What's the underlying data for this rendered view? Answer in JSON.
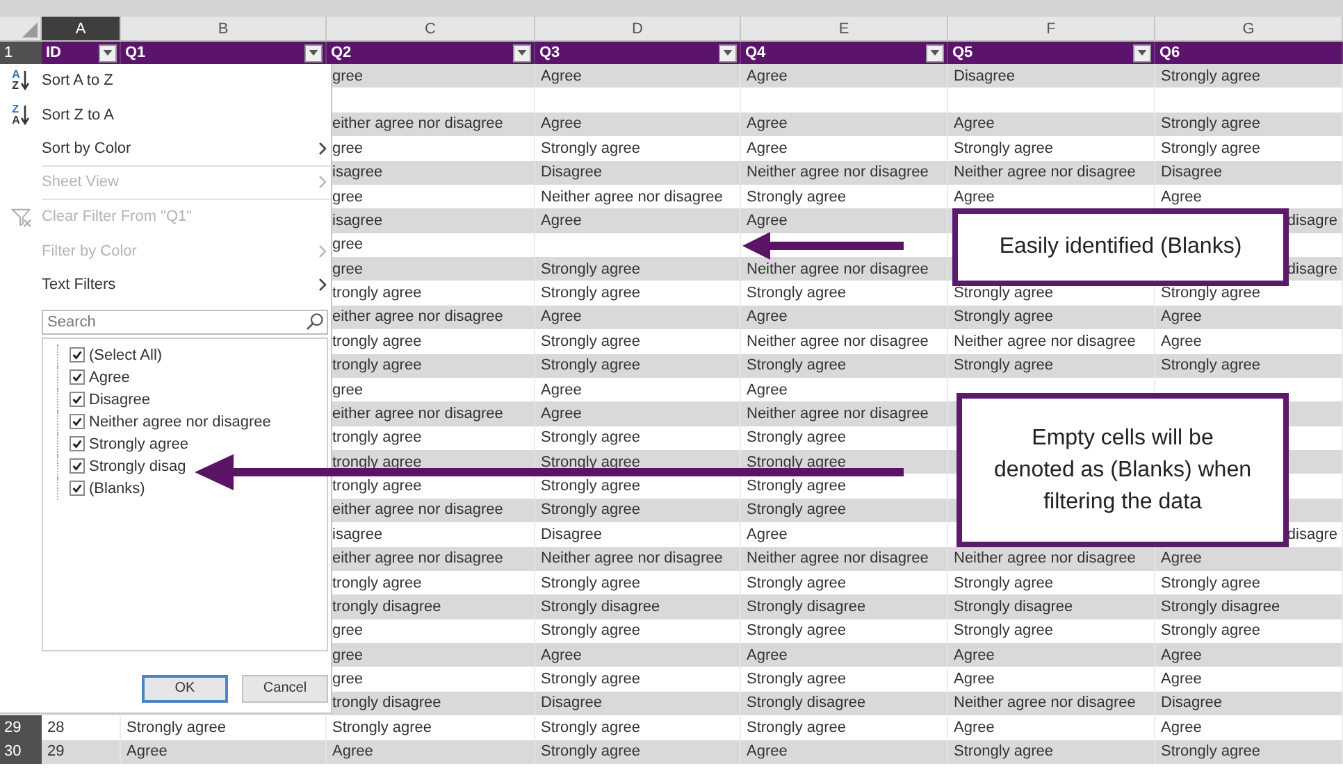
{
  "sheet": {
    "column_letters": [
      {
        "label": "A",
        "selected": true
      },
      {
        "label": "B",
        "selected": false
      },
      {
        "label": "C",
        "selected": false
      },
      {
        "label": "D",
        "selected": false
      },
      {
        "label": "E",
        "selected": false
      },
      {
        "label": "F",
        "selected": false
      },
      {
        "label": "G",
        "selected": false
      }
    ],
    "header_row": {
      "number": "1",
      "cells": [
        {
          "label": "ID",
          "filter": true
        },
        {
          "label": "Q1",
          "filter": true
        },
        {
          "label": "Q2",
          "filter": true
        },
        {
          "label": "Q3",
          "filter": true
        },
        {
          "label": "Q4",
          "filter": true
        },
        {
          "label": "Q5",
          "filter": true
        },
        {
          "label": "Q6",
          "filter": false
        }
      ]
    },
    "rows": [
      {
        "cells": [
          null,
          null,
          "gree",
          "Agree",
          "Agree",
          "Disagree",
          "Strongly agree"
        ]
      },
      {
        "cells": [
          null,
          null,
          null,
          null,
          null,
          null,
          null
        ]
      },
      {
        "cells": [
          null,
          null,
          "either agree nor disagree",
          "Agree",
          "Agree",
          "Agree",
          "Strongly agree"
        ]
      },
      {
        "cells": [
          null,
          null,
          "gree",
          "Strongly agree",
          "Agree",
          "Strongly agree",
          "Strongly agree"
        ]
      },
      {
        "cells": [
          null,
          null,
          "isagree",
          "Disagree",
          "Neither agree nor disagree",
          "Neither agree nor disagree",
          "Disagree"
        ]
      },
      {
        "cells": [
          null,
          null,
          "gree",
          "Neither agree nor disagree",
          "Strongly agree",
          "Agree",
          "Agree"
        ]
      },
      {
        "cells": [
          null,
          null,
          "isagree",
          "Agree",
          "Agree",
          null,
          {
            "text": "disagre",
            "clipped": true
          }
        ]
      },
      {
        "cells": [
          null,
          null,
          "gree",
          null,
          null,
          null,
          null
        ]
      },
      {
        "cells": [
          null,
          null,
          "gree",
          "Strongly agree",
          "Neither agree nor disagree",
          null,
          {
            "text": "disagre",
            "clipped": true
          }
        ]
      },
      {
        "cells": [
          null,
          null,
          "trongly agree",
          "Strongly agree",
          "Strongly agree",
          "Strongly agree",
          "Strongly agree"
        ]
      },
      {
        "cells": [
          null,
          null,
          "either agree nor disagree",
          "Agree",
          "Agree",
          "Strongly agree",
          "Agree"
        ]
      },
      {
        "cells": [
          null,
          null,
          "trongly agree",
          "Strongly agree",
          "Neither agree nor disagree",
          "Neither agree nor disagree",
          "Agree"
        ]
      },
      {
        "cells": [
          null,
          null,
          "trongly agree",
          "Strongly agree",
          "Strongly agree",
          "Strongly agree",
          "Strongly agree"
        ]
      },
      {
        "cells": [
          null,
          null,
          "gree",
          "Agree",
          "Agree",
          null,
          null
        ]
      },
      {
        "cells": [
          null,
          null,
          "either agree nor disagree",
          "Agree",
          "Neither agree nor disagree",
          null,
          null
        ]
      },
      {
        "cells": [
          null,
          null,
          "trongly agree",
          "Strongly agree",
          "Strongly agree",
          null,
          null
        ]
      },
      {
        "cells": [
          null,
          null,
          "trongly agree",
          "Strongly agree",
          "Strongly agree",
          null,
          null
        ]
      },
      {
        "cells": [
          null,
          null,
          "trongly agree",
          "Strongly agree",
          "Strongly agree",
          null,
          null
        ]
      },
      {
        "cells": [
          null,
          null,
          "either agree nor disagree",
          "Strongly agree",
          "Strongly agree",
          null,
          null
        ]
      },
      {
        "cells": [
          null,
          null,
          "isagree",
          "Disagree",
          "Agree",
          null,
          {
            "text": "disagre",
            "clipped": true
          }
        ]
      },
      {
        "cells": [
          null,
          null,
          "either agree nor disagree",
          "Neither agree nor disagree",
          "Neither agree nor disagree",
          "Neither agree nor disagree",
          "Agree"
        ]
      },
      {
        "cells": [
          null,
          null,
          "trongly agree",
          "Strongly agree",
          "Strongly agree",
          "Strongly agree",
          "Strongly agree"
        ]
      },
      {
        "cells": [
          null,
          null,
          "trongly disagree",
          "Strongly disagree",
          "Strongly disagree",
          "Strongly disagree",
          "Strongly disagree"
        ]
      },
      {
        "cells": [
          null,
          null,
          "gree",
          "Strongly agree",
          "Strongly agree",
          "Strongly agree",
          "Strongly agree"
        ]
      },
      {
        "cells": [
          null,
          null,
          "gree",
          "Agree",
          "Agree",
          "Agree",
          "Agree"
        ]
      },
      {
        "cells": [
          null,
          null,
          "gree",
          "Strongly agree",
          "Strongly agree",
          "Agree",
          "Agree"
        ]
      },
      {
        "cells": [
          null,
          null,
          "trongly disagree",
          "Disagree",
          "Strongly disagree",
          "Neither agree nor disagree",
          "Disagree"
        ]
      },
      {
        "number": "29",
        "cells": [
          "28",
          "Strongly agree",
          "Strongly agree",
          "Strongly agree",
          "Strongly agree",
          "Agree",
          "Agree"
        ]
      },
      {
        "number": "30",
        "cells": [
          "29",
          "Agree",
          "Agree",
          "Strongly agree",
          "Agree",
          "Strongly agree",
          "Strongly agree"
        ]
      }
    ]
  },
  "filter_menu": {
    "items": [
      {
        "kind": "sort",
        "icon_letters": [
          "A",
          "Z"
        ],
        "label": "Sort A to Z",
        "disabled": false,
        "submenu": false,
        "divider_after": false
      },
      {
        "kind": "sort",
        "icon_letters": [
          "Z",
          "A"
        ],
        "label": "Sort Z to A",
        "disabled": false,
        "submenu": false,
        "divider_after": false
      },
      {
        "kind": "plain",
        "label": "Sort by Color",
        "disabled": false,
        "submenu": true,
        "divider_after": true
      },
      {
        "kind": "plain",
        "label": "Sheet View",
        "disabled": true,
        "submenu": true,
        "divider_after": true
      },
      {
        "kind": "clear",
        "label": "Clear Filter From \"Q1\"",
        "disabled": true,
        "submenu": false,
        "divider_after": false
      },
      {
        "kind": "plain",
        "label": "Filter by Color",
        "disabled": true,
        "submenu": true,
        "divider_after": false
      },
      {
        "kind": "plain",
        "label": "Text Filters",
        "disabled": false,
        "submenu": true,
        "divider_after": false
      }
    ],
    "search": {
      "placeholder": "Search"
    },
    "values": [
      {
        "label": "(Select All)",
        "checked": true
      },
      {
        "label": "Agree",
        "checked": true
      },
      {
        "label": "Disagree",
        "checked": true
      },
      {
        "label": "Neither agree nor disagree",
        "checked": true
      },
      {
        "label": "Strongly agree",
        "checked": true
      },
      {
        "label": "Strongly disag",
        "checked": true
      },
      {
        "label": "(Blanks)",
        "checked": true
      }
    ],
    "buttons": [
      {
        "label": "OK",
        "default": true
      },
      {
        "label": "Cancel",
        "default": false
      }
    ]
  },
  "callouts": [
    {
      "text": "Easily identified (Blanks)"
    },
    {
      "text": "Empty cells will be denoted as (Blanks) when filtering the data"
    }
  ]
}
